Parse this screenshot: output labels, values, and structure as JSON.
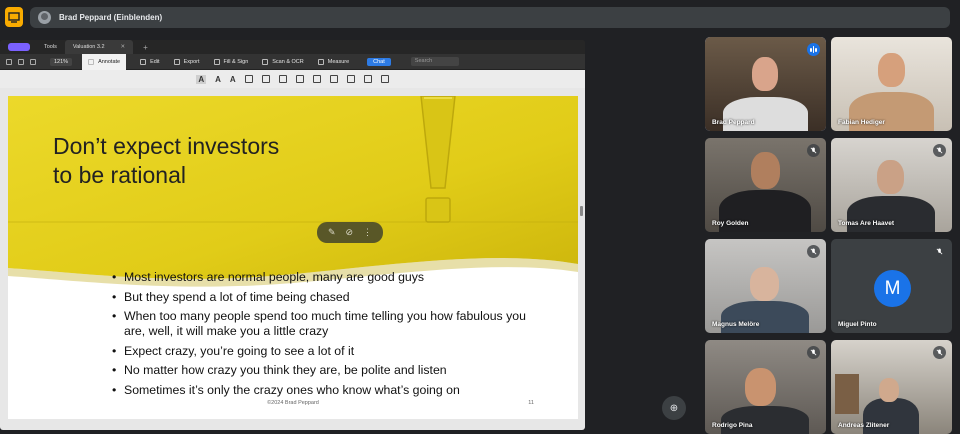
{
  "meeting": {
    "presenter_label": "Brad Peppard (Einblenden)",
    "present_icon": "present-screen-icon",
    "zoom_icon": "zoom-in-icon"
  },
  "viewer": {
    "tabs": [
      "Tools",
      "Valuation 3.2"
    ],
    "zoom": "121%",
    "toolbar": [
      "Annotate",
      "Edit",
      "Export",
      "Fill & Sign",
      "Scan & OCR",
      "Measure"
    ],
    "chat_label": "Chat",
    "search_placeholder": "Search"
  },
  "slide": {
    "title_line1": "Don’t expect investors",
    "title_line2": "to be rational",
    "bullets": [
      "Most investors are normal people, many are good guys",
      "But they spend a lot of time being chased",
      "When too many people spend too much time telling you how fabulous you are, well, it will make you a little crazy",
      "Expect crazy, you’re going to see a lot of it",
      "No matter how crazy you think they are, be polite and listen",
      "Sometimes it’s only the crazy ones who know what’s going on"
    ],
    "footer": "©2024 Brad Peppard",
    "page": "11",
    "colors": {
      "banner": "#e6d21a",
      "banner_dark": "#c7b20e"
    }
  },
  "participants": [
    {
      "name": "Brad Peppard",
      "status": "speaking"
    },
    {
      "name": "Fabian Hediger",
      "status": ""
    },
    {
      "name": "Roy Golden",
      "status": "muted"
    },
    {
      "name": "Tomas Are Haavet",
      "status": "muted"
    },
    {
      "name": "Magnus Melöre",
      "status": "muted"
    },
    {
      "name": "Miguel Pinto",
      "status": "muted",
      "initial": "M"
    },
    {
      "name": "Rodrigo Pina",
      "status": "muted"
    },
    {
      "name": "Andreas Zlitener",
      "status": "muted"
    }
  ]
}
